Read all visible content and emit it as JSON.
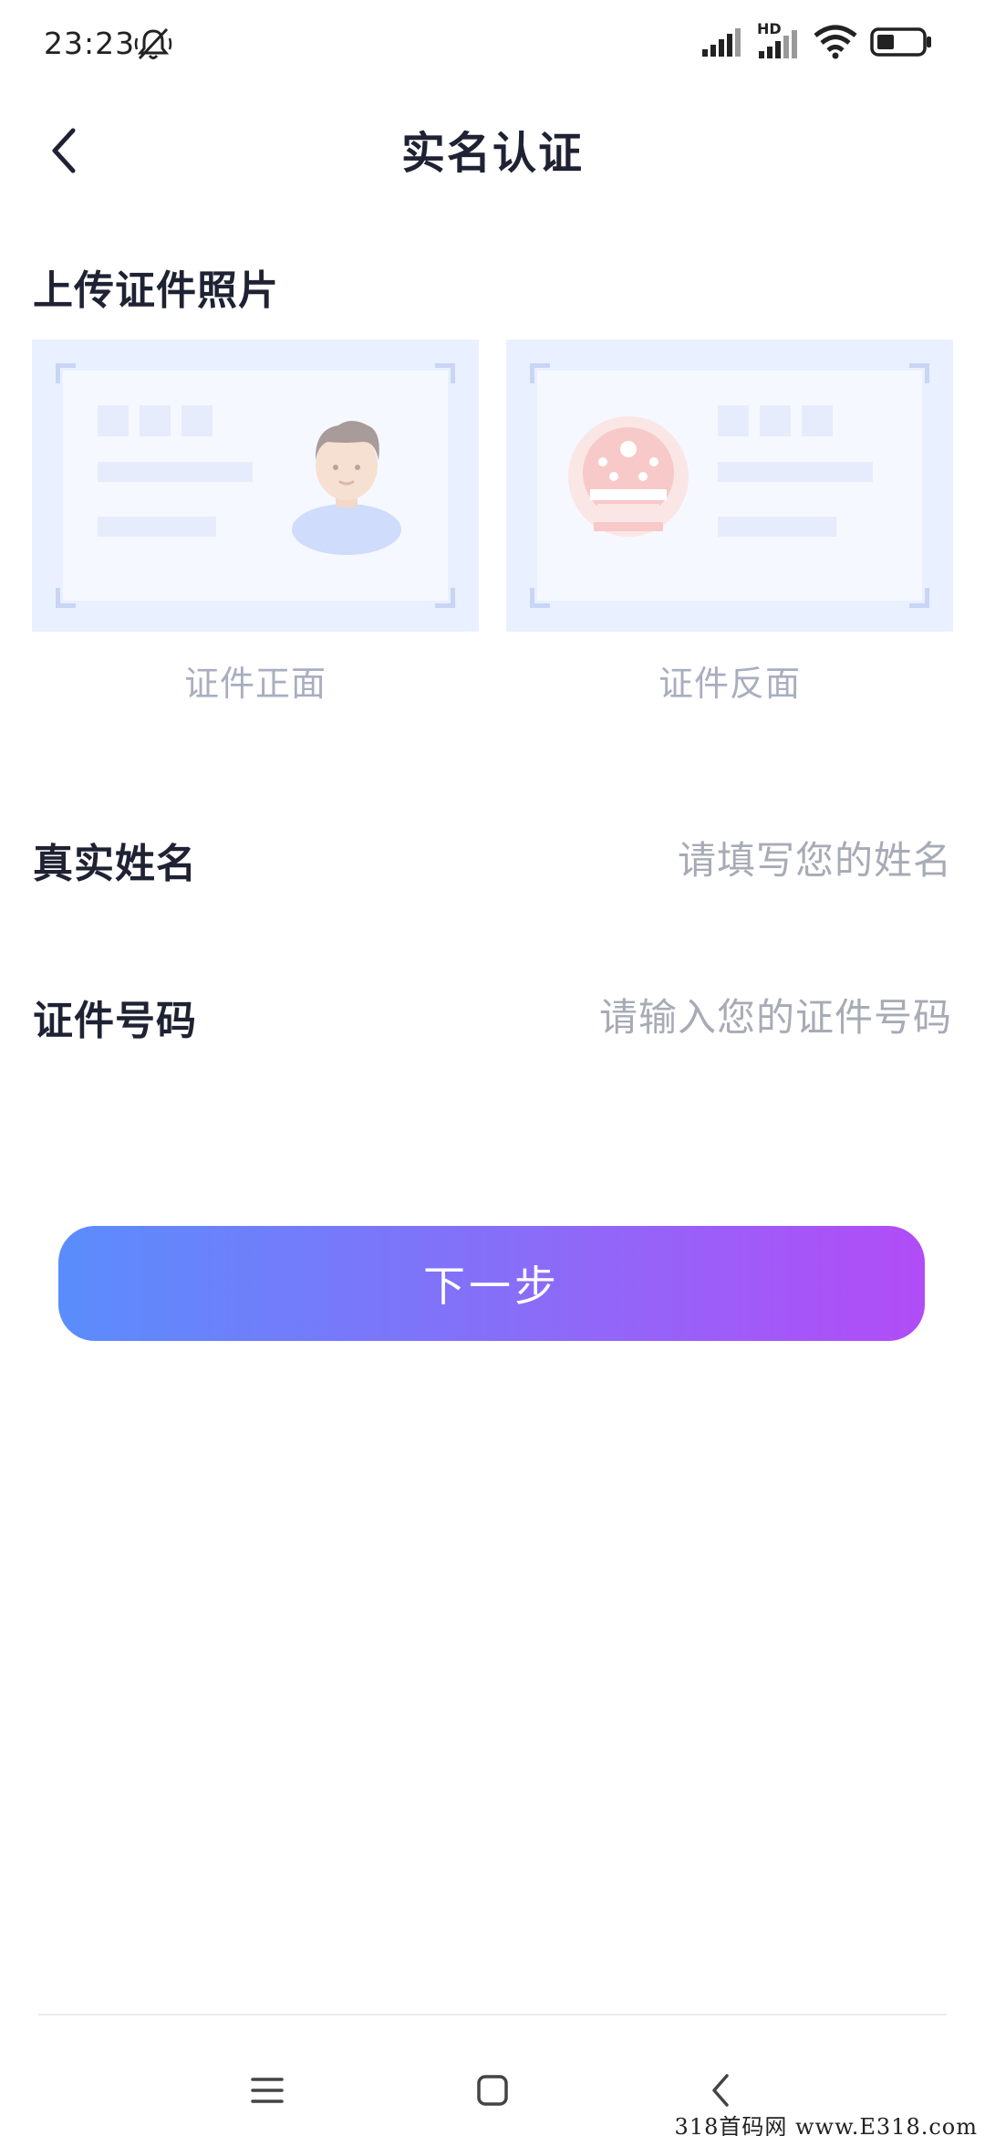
{
  "status_bar": {
    "time": "23:23",
    "network_badge": "HD",
    "icons": [
      "mute-icon",
      "signal-icon",
      "signal-hd-icon",
      "wifi-icon",
      "battery-icon"
    ]
  },
  "header": {
    "title": "实名认证",
    "back_icon": "chevron-left-icon"
  },
  "upload": {
    "section_title": "上传证件照片",
    "cards": [
      {
        "caption": "证件正面",
        "icon": "person-portrait-icon"
      },
      {
        "caption": "证件反面",
        "icon": "national-emblem-icon"
      }
    ]
  },
  "form": {
    "name": {
      "label": "真实姓名",
      "value": "",
      "placeholder": "请填写您的姓名"
    },
    "id_number": {
      "label": "证件号码",
      "value": "",
      "placeholder": "请输入您的证件号码"
    }
  },
  "actions": {
    "next_label": "下一步"
  },
  "nav_bar": {
    "icons": [
      "menu-icon",
      "home-icon",
      "back-icon"
    ]
  },
  "watermark": "318首码网 www.E318.com",
  "colors": {
    "title": "#1e2233",
    "caption": "#a9aec0",
    "placeholder": "#a7abb6",
    "card_bg": "#e9f0ff",
    "button_gradient_start": "#5a8dfc",
    "button_gradient_end": "#b24cf7"
  }
}
